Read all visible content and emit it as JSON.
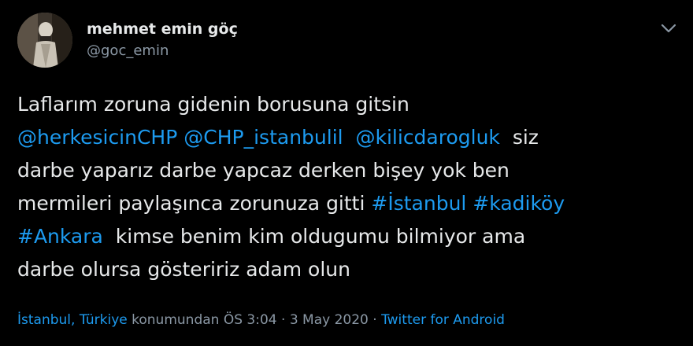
{
  "user": {
    "name": "mehmet emin göç",
    "handle": "@goc_emin"
  },
  "tweet": {
    "line1": "Laflarım zoruna gidenin borusuna gitsin",
    "mention1": "@herkesicinCHP",
    "mention2": "@CHP_istanbulil",
    "mention3": "@kilicdarogluk",
    "line2_end": "siz",
    "line3": "darbe yaparız darbe yapcaz derken bişey yok ben",
    "line4_start": "mermileri paylaşınca zorunuza gitti",
    "hashtag1": "#İstanbul",
    "hashtag2": "#kadiköy",
    "hashtag3": "#Ankara",
    "line5_end": "kimse benim kim oldugumu bilmiyor ama",
    "line6": "darbe olursa gösteririz adam olun"
  },
  "meta": {
    "location": "İstanbul, Türkiye",
    "location_suffix": "konumundan",
    "time": "ÖS 3:04",
    "separator1": "·",
    "date": "3 May 2020",
    "separator2": "·",
    "source": "Twitter for Android"
  },
  "icons": {
    "avatar": "avatar",
    "chevron": "chevron-down-icon"
  },
  "colors": {
    "background": "#000000",
    "text": "#e7e9ea",
    "secondary": "#8b98a5",
    "link": "#1d9bf0"
  }
}
